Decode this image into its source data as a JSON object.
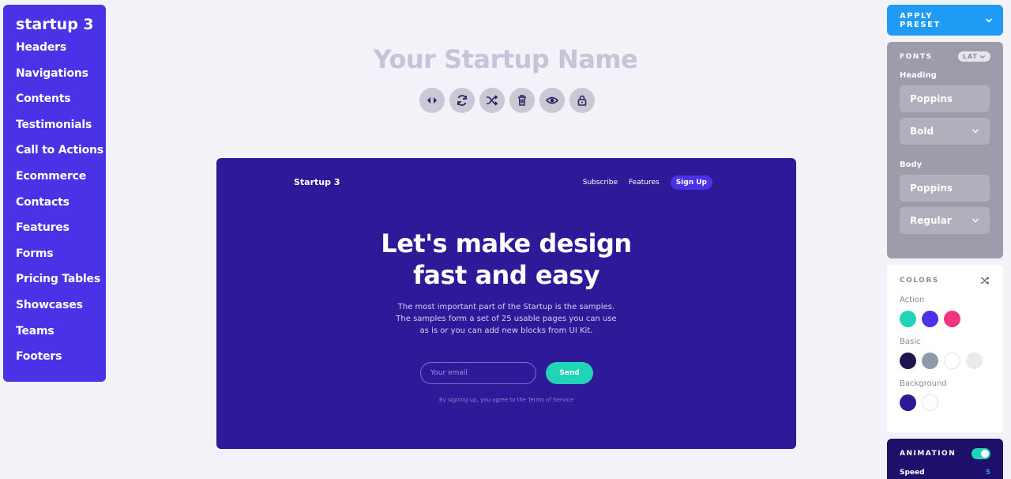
{
  "sidebar": {
    "brand": "startup 3",
    "items": [
      "Headers",
      "Navigations",
      "Contents",
      "Testimonials",
      "Call to Actions",
      "Ecommerce",
      "Contacts",
      "Features",
      "Forms",
      "Pricing Tables",
      "Showcases",
      "Teams",
      "Footers"
    ]
  },
  "project": {
    "title": "Your Startup Name"
  },
  "toolbar": {
    "icons": [
      "swap-icon",
      "refresh-icon",
      "shuffle-icon",
      "trash-icon",
      "eye-icon",
      "lock-icon"
    ]
  },
  "preview": {
    "logo": "Startup 3",
    "nav": {
      "subscribe": "Subscribe",
      "features": "Features",
      "signup": "Sign Up"
    },
    "hero_line1": "Let's make design",
    "hero_line2": "fast and easy",
    "sub_line1": "The most important part of the Startup is the samples.",
    "sub_line2": "The samples form a set of 25 usable pages you can use",
    "sub_line3": "as is or you can add new blocks from UI Kit.",
    "email_placeholder": "Your email",
    "send": "Send",
    "terms": "By signing up, you agree to the Terms of Service",
    "bg_color": "#2e1a99"
  },
  "panel": {
    "apply_preset": "APPLY PRESET",
    "fonts": {
      "label": "FONTS",
      "lang": "LAT",
      "heading_label": "Heading",
      "heading_font": "Poppins",
      "heading_weight": "Bold",
      "body_label": "Body",
      "body_font": "Poppins",
      "body_weight": "Regular"
    },
    "colors": {
      "label": "COLORS",
      "action_label": "Action",
      "action": [
        "#20d4b8",
        "#4a32e6",
        "#f0367a"
      ],
      "basic_label": "Basic",
      "basic": [
        "#1e1454",
        "#8f9aa8",
        "#ffffff",
        "#e9e9ee"
      ],
      "background_label": "Background",
      "background": [
        "#2e1a99",
        "#ffffff"
      ]
    },
    "animation": {
      "label": "ANIMATION",
      "enabled": true,
      "speed_label": "Speed",
      "speed_value": "5"
    }
  }
}
